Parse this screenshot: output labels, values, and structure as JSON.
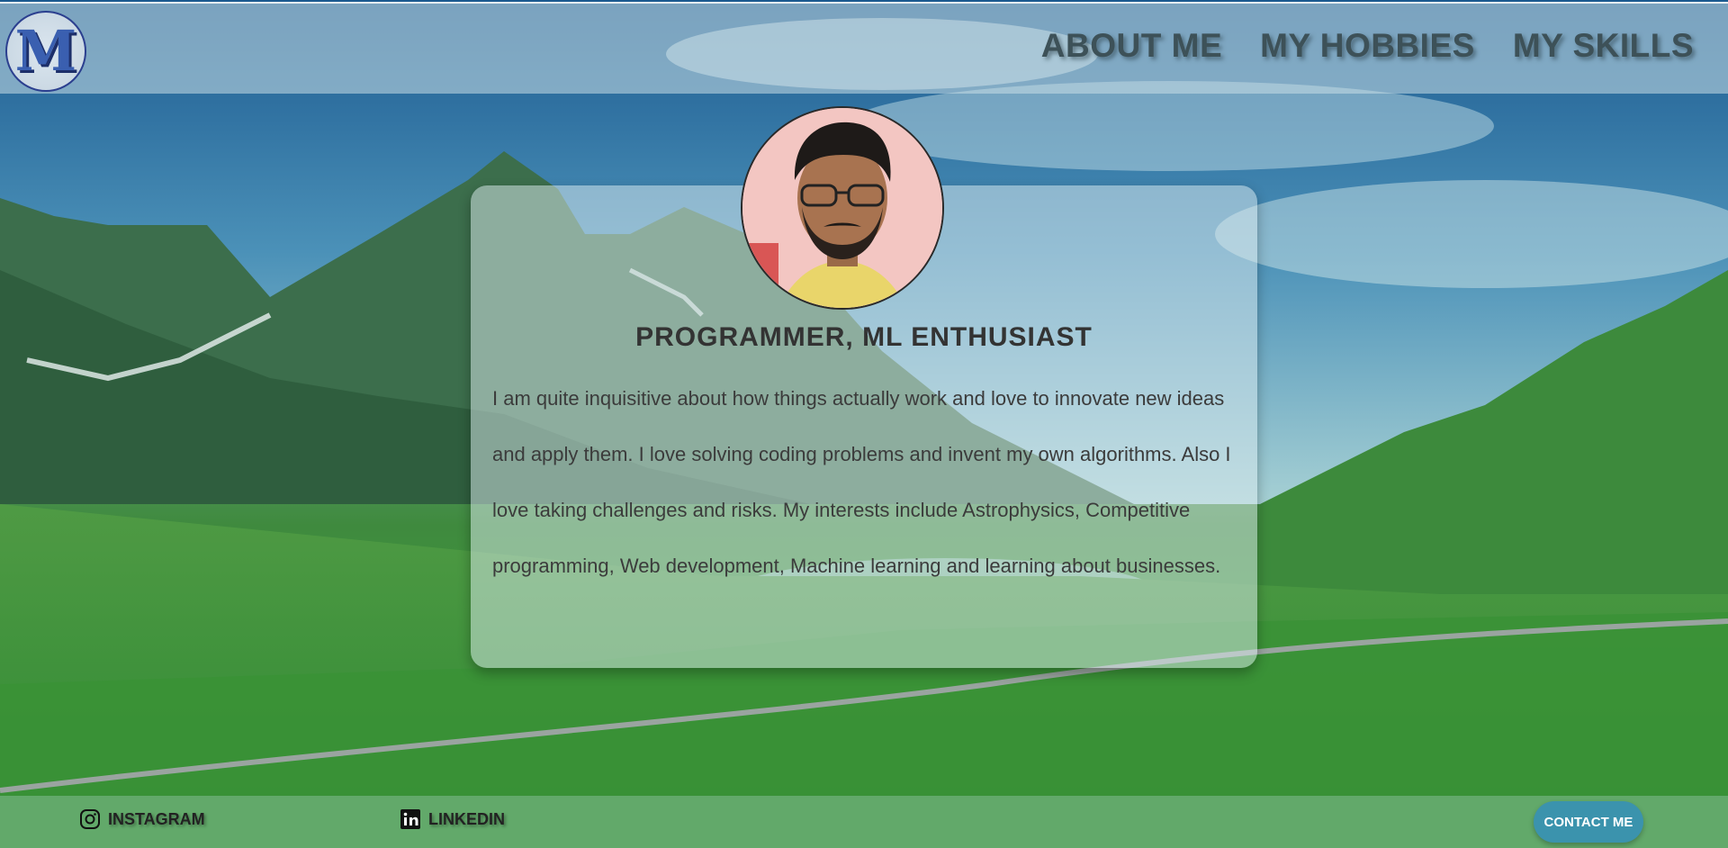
{
  "header": {
    "logo_letter": "M",
    "nav": [
      {
        "label": "ABOUT ME"
      },
      {
        "label": "MY HOBBIES"
      },
      {
        "label": "MY SKILLS"
      }
    ]
  },
  "profile": {
    "title": "PROGRAMMER, ML ENTHUSIAST",
    "description": "I am quite inquisitive about how things actually work and love to innovate new ideas and apply them. I love solving coding problems and invent my own algorithms. Also I love taking challenges and risks. My interests include Astrophysics, Competitive programming, Web development, Machine learning and learning about businesses."
  },
  "footer": {
    "instagram_label": "INSTAGRAM",
    "linkedin_label": "LINKEDIN",
    "contact_label": "CONTACT ME"
  },
  "icons": {
    "instagram": "instagram-icon",
    "linkedin": "linkedin-icon"
  },
  "colors": {
    "nav_text": "#3d5158",
    "contact_button": "#3b93ad"
  }
}
